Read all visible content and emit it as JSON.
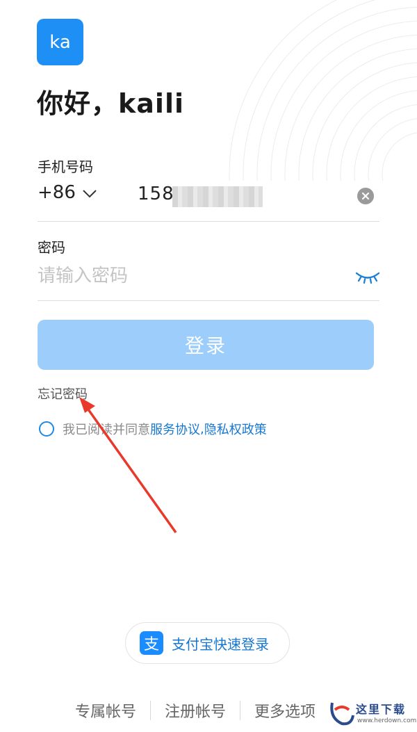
{
  "header": {
    "avatar_text": "ka",
    "greeting": "你好，kaili"
  },
  "phone": {
    "label": "手机号码",
    "country_code": "+86",
    "value": "158"
  },
  "password": {
    "label": "密码",
    "placeholder": "请输入密码",
    "value": ""
  },
  "actions": {
    "login_label": "登录",
    "forgot_label": "忘记密码"
  },
  "agreement": {
    "prefix": "我已阅读并同意",
    "terms": "服务协议",
    "separator": ", ",
    "privacy": "隐私权政策",
    "checked": false
  },
  "alipay": {
    "icon_glyph": "支",
    "label": "支付宝快速登录"
  },
  "footer": {
    "links": [
      "专属帐号",
      "注册帐号",
      "更多选项"
    ]
  },
  "watermark": {
    "text": "这里下载",
    "url": "www.herdown.com"
  },
  "colors": {
    "brand": "#1e90f5",
    "login_disabled": "#9ccdfb",
    "link": "#1677d2",
    "annotation_arrow": "#e8392b"
  }
}
